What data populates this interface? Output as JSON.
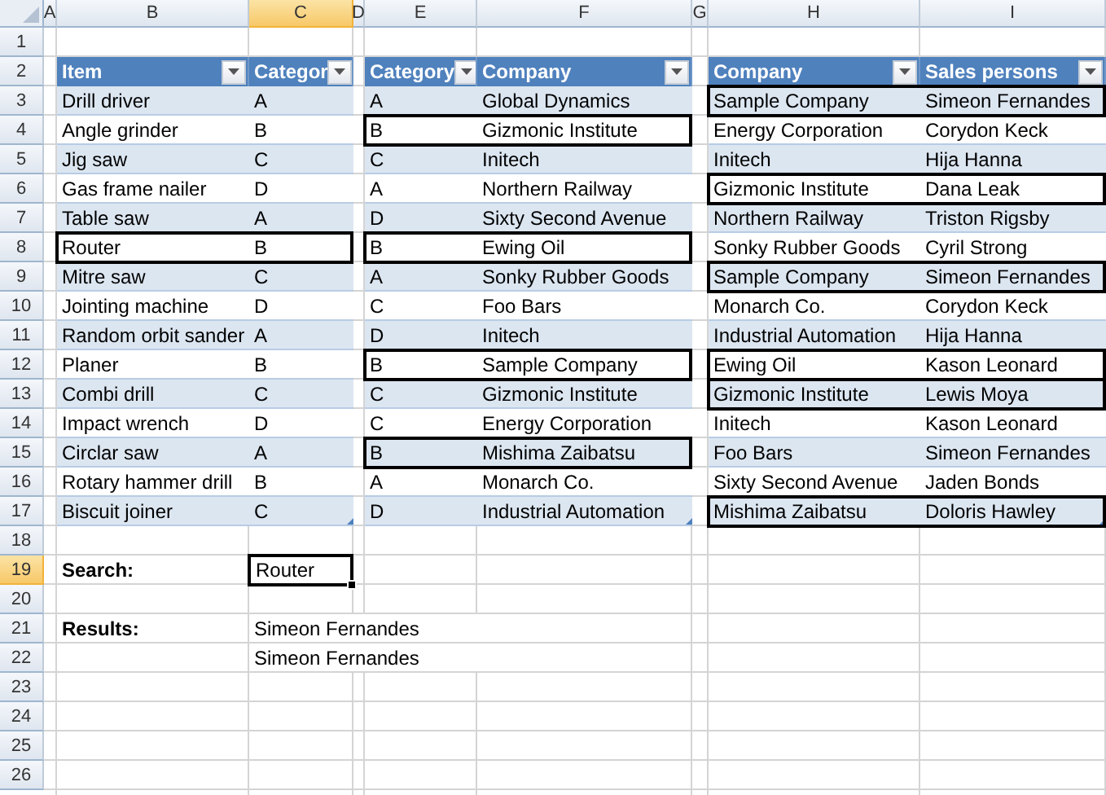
{
  "column_headers": [
    {
      "label": "A",
      "selected": false
    },
    {
      "label": "B",
      "selected": false
    },
    {
      "label": "C",
      "selected": true
    },
    {
      "label": "D",
      "selected": false
    },
    {
      "label": "E",
      "selected": false
    },
    {
      "label": "F",
      "selected": false
    },
    {
      "label": "G",
      "selected": false
    },
    {
      "label": "H",
      "selected": false
    },
    {
      "label": "I",
      "selected": false
    }
  ],
  "row_headers": [
    {
      "label": "1",
      "selected": false
    },
    {
      "label": "2",
      "selected": false
    },
    {
      "label": "3",
      "selected": false
    },
    {
      "label": "4",
      "selected": false
    },
    {
      "label": "5",
      "selected": false
    },
    {
      "label": "6",
      "selected": false
    },
    {
      "label": "7",
      "selected": false
    },
    {
      "label": "8",
      "selected": false
    },
    {
      "label": "9",
      "selected": false
    },
    {
      "label": "10",
      "selected": false
    },
    {
      "label": "11",
      "selected": false
    },
    {
      "label": "12",
      "selected": false
    },
    {
      "label": "13",
      "selected": false
    },
    {
      "label": "14",
      "selected": false
    },
    {
      "label": "15",
      "selected": false
    },
    {
      "label": "16",
      "selected": false
    },
    {
      "label": "17",
      "selected": false
    },
    {
      "label": "18",
      "selected": false
    },
    {
      "label": "19",
      "selected": true
    },
    {
      "label": "20",
      "selected": false
    },
    {
      "label": "21",
      "selected": false
    },
    {
      "label": "22",
      "selected": false
    },
    {
      "label": "23",
      "selected": false
    },
    {
      "label": "24",
      "selected": false
    },
    {
      "label": "25",
      "selected": false
    },
    {
      "label": "26",
      "selected": false
    }
  ],
  "tables": [
    {
      "columns": [
        "Item",
        "Categor"
      ],
      "rows": [
        {
          "cells": [
            "Drill driver",
            "A"
          ],
          "highlighted": false
        },
        {
          "cells": [
            "Angle grinder",
            "B"
          ],
          "highlighted": false
        },
        {
          "cells": [
            "Jig saw",
            "C"
          ],
          "highlighted": false
        },
        {
          "cells": [
            "Gas frame nailer",
            "D"
          ],
          "highlighted": false
        },
        {
          "cells": [
            "Table saw",
            "A"
          ],
          "highlighted": false
        },
        {
          "cells": [
            "Router",
            "B"
          ],
          "highlighted": true
        },
        {
          "cells": [
            "Mitre saw",
            "C"
          ],
          "highlighted": false
        },
        {
          "cells": [
            "Jointing machine",
            "D"
          ],
          "highlighted": false
        },
        {
          "cells": [
            "Random orbit sander",
            "A"
          ],
          "highlighted": false
        },
        {
          "cells": [
            "Planer",
            "B"
          ],
          "highlighted": false
        },
        {
          "cells": [
            "Combi drill",
            "C"
          ],
          "highlighted": false
        },
        {
          "cells": [
            "Impact wrench",
            "D"
          ],
          "highlighted": false
        },
        {
          "cells": [
            "Circlar saw",
            "A"
          ],
          "highlighted": false
        },
        {
          "cells": [
            "Rotary hammer drill",
            "B"
          ],
          "highlighted": false
        },
        {
          "cells": [
            "Biscuit joiner",
            "C"
          ],
          "highlighted": false
        }
      ]
    },
    {
      "columns": [
        "Category",
        "Company"
      ],
      "rows": [
        {
          "cells": [
            "A",
            "Global Dynamics"
          ],
          "highlighted": false
        },
        {
          "cells": [
            "B",
            "Gizmonic Institute"
          ],
          "highlighted": true
        },
        {
          "cells": [
            "C",
            "Initech"
          ],
          "highlighted": false
        },
        {
          "cells": [
            "A",
            "Northern Railway"
          ],
          "highlighted": false
        },
        {
          "cells": [
            "D",
            "Sixty Second Avenue"
          ],
          "highlighted": false
        },
        {
          "cells": [
            "B",
            "Ewing Oil"
          ],
          "highlighted": true
        },
        {
          "cells": [
            "A",
            "Sonky Rubber Goods"
          ],
          "highlighted": false
        },
        {
          "cells": [
            "C",
            "Foo Bars"
          ],
          "highlighted": false
        },
        {
          "cells": [
            "D",
            "Initech"
          ],
          "highlighted": false
        },
        {
          "cells": [
            "B",
            "Sample Company"
          ],
          "highlighted": true
        },
        {
          "cells": [
            "C",
            "Gizmonic Institute"
          ],
          "highlighted": false
        },
        {
          "cells": [
            "C",
            "Energy Corporation"
          ],
          "highlighted": false
        },
        {
          "cells": [
            "B",
            "Mishima Zaibatsu"
          ],
          "highlighted": true
        },
        {
          "cells": [
            "A",
            "Monarch Co."
          ],
          "highlighted": false
        },
        {
          "cells": [
            "D",
            "Industrial Automation"
          ],
          "highlighted": false
        }
      ]
    },
    {
      "columns": [
        "Company",
        "Sales persons"
      ],
      "rows": [
        {
          "cells": [
            "Sample Company",
            "Simeon Fernandes"
          ],
          "highlighted": true
        },
        {
          "cells": [
            "Energy Corporation",
            "Corydon Keck"
          ],
          "highlighted": false
        },
        {
          "cells": [
            "Initech",
            "Hija Hanna"
          ],
          "highlighted": false
        },
        {
          "cells": [
            "Gizmonic Institute",
            "Dana Leak"
          ],
          "highlighted": true
        },
        {
          "cells": [
            "Northern Railway",
            "Triston Rigsby"
          ],
          "highlighted": false
        },
        {
          "cells": [
            "Sonky Rubber Goods",
            "Cyril Strong"
          ],
          "highlighted": false
        },
        {
          "cells": [
            "Sample Company",
            "Simeon Fernandes"
          ],
          "highlighted": true
        },
        {
          "cells": [
            "Monarch Co.",
            "Corydon Keck"
          ],
          "highlighted": false
        },
        {
          "cells": [
            "Industrial Automation",
            "Hija Hanna"
          ],
          "highlighted": false
        },
        {
          "cells": [
            "Ewing Oil",
            "Kason Leonard"
          ],
          "highlighted": true
        },
        {
          "cells": [
            "Gizmonic Institute",
            "Lewis Moya"
          ],
          "highlighted": true
        },
        {
          "cells": [
            "Initech",
            "Kason Leonard"
          ],
          "highlighted": false
        },
        {
          "cells": [
            "Foo Bars",
            "Simeon Fernandes"
          ],
          "highlighted": false
        },
        {
          "cells": [
            "Sixty Second Avenue",
            "Jaden Bonds"
          ],
          "highlighted": false
        },
        {
          "cells": [
            "Mishima Zaibatsu",
            "Doloris Hawley"
          ],
          "highlighted": true
        }
      ]
    }
  ],
  "search": {
    "label": "Search:",
    "value": "Router"
  },
  "results": {
    "label": "Results:",
    "values": [
      "Simeon Fernandes",
      "Simeon Fernandes"
    ]
  }
}
